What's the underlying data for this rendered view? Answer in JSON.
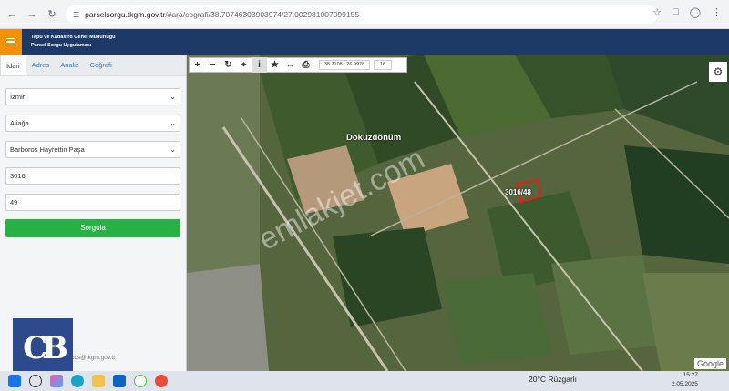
{
  "browser": {
    "url_domain": "parselsorgu.tkgm.gov.tr",
    "url_path": "/#ara/cografi/38.70746303903974/27.002981007099155"
  },
  "app": {
    "title_line1": "Tapu ve Kadastro Genel Müdürlüğü",
    "title_line2": "Parsel Sorgu Uygulaması"
  },
  "sidebar": {
    "tabs": [
      {
        "label": "İdari"
      },
      {
        "label": "Adres"
      },
      {
        "label": "Analiz"
      },
      {
        "label": "Coğrafi"
      }
    ],
    "province": "İzmir",
    "district": "Aliağa",
    "neighborhood": "Barboros Hayrettin Paşa",
    "block": "3016",
    "parcel": "49",
    "query_button": "Sorgula",
    "email": "cbs@tkgm.gov.tr",
    "logo_text": "CB"
  },
  "map": {
    "coordinates": "38.7108 : 26.9978",
    "zoom": "16",
    "place_label": "Dokuzdönüm",
    "parcel_label": "3016/48",
    "watermark": "emlakjet.com",
    "attribution": "Google"
  },
  "taskbar": {
    "temperature": "20°C",
    "weather_text": "Rüzgarlı",
    "time": "15:27",
    "date": "2.05.2025"
  },
  "colors": {
    "header": "#1d3a66",
    "accent": "#f39200",
    "query_button": "#28b246",
    "parcel_highlight": "#e02020"
  }
}
